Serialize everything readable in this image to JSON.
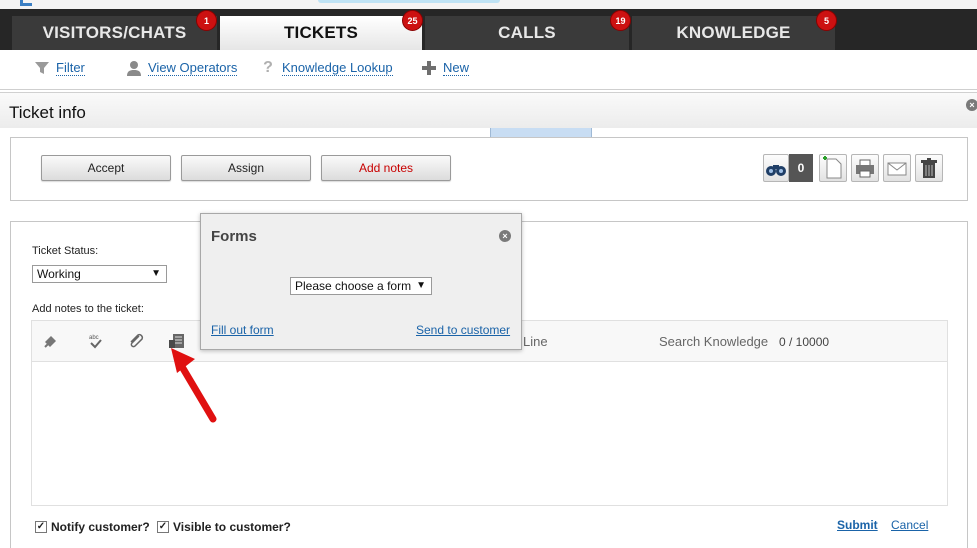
{
  "tabs": [
    {
      "label": "VISITORS/CHATS",
      "badge": "1"
    },
    {
      "label": "TICKETS",
      "badge": "25"
    },
    {
      "label": "CALLS",
      "badge": "19"
    },
    {
      "label": "KNOWLEDGE",
      "badge": "5"
    }
  ],
  "toolbar": {
    "filter": "Filter",
    "view_operators": "View Operators",
    "knowledge_lookup": "Knowledge Lookup",
    "new": "New"
  },
  "ticket_info": {
    "title": "Ticket info",
    "accept": "Accept",
    "assign": "Assign",
    "add_notes": "Add notes",
    "search_count": "0"
  },
  "form": {
    "status_label": "Ticket Status:",
    "status_value": "Working",
    "notes_label": "Add notes to the ticket:",
    "partial_text": "Line",
    "search_knowledge": "Search Knowledge",
    "char_count": "0 / 10000",
    "notify_customer": "Notify customer?",
    "visible_to_customer": "Visible to customer?",
    "submit": "Submit",
    "cancel": "Cancel"
  },
  "popup": {
    "title": "Forms",
    "select_value": "Please choose a form",
    "fill_out": "Fill out form",
    "send_to_customer": "Send to customer"
  },
  "colors": {
    "tab_bar": "#262626",
    "badge": "#cc1111",
    "link": "#1a63a8",
    "accent_red": "#c80000",
    "arrow": "#e01010"
  }
}
